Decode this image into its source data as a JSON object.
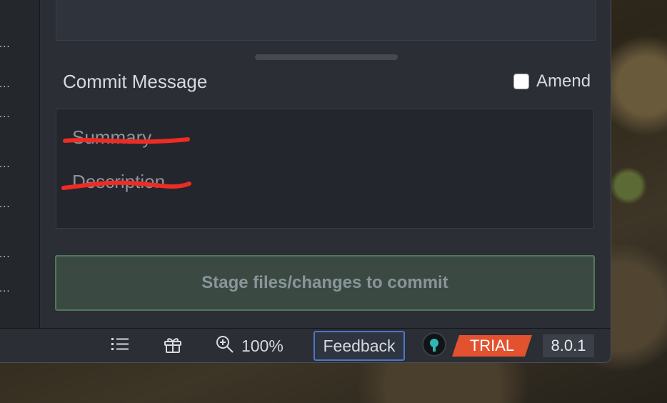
{
  "sidebar": {
    "truncated_items": [
      "...",
      "...",
      "...",
      "...",
      "...",
      "...",
      "..."
    ]
  },
  "commit": {
    "title": "Commit Message",
    "amend_label": "Amend",
    "amend_checked": false,
    "summary_placeholder": "Summary",
    "description_placeholder": "Description",
    "stage_button_label": "Stage files/changes to commit"
  },
  "statusbar": {
    "list_icon": "list-icon",
    "gift_icon": "gift-icon",
    "zoom_icon": "zoom-in-icon",
    "zoom_level": "100%",
    "feedback_label": "Feedback",
    "trial_label": "TRIAL",
    "version": "8.0.1"
  },
  "colors": {
    "trial_badge": "#e2522f",
    "feedback_border": "#4d77c8",
    "stage_button_border": "#4f7a58",
    "redaction": "#ee2b24"
  }
}
